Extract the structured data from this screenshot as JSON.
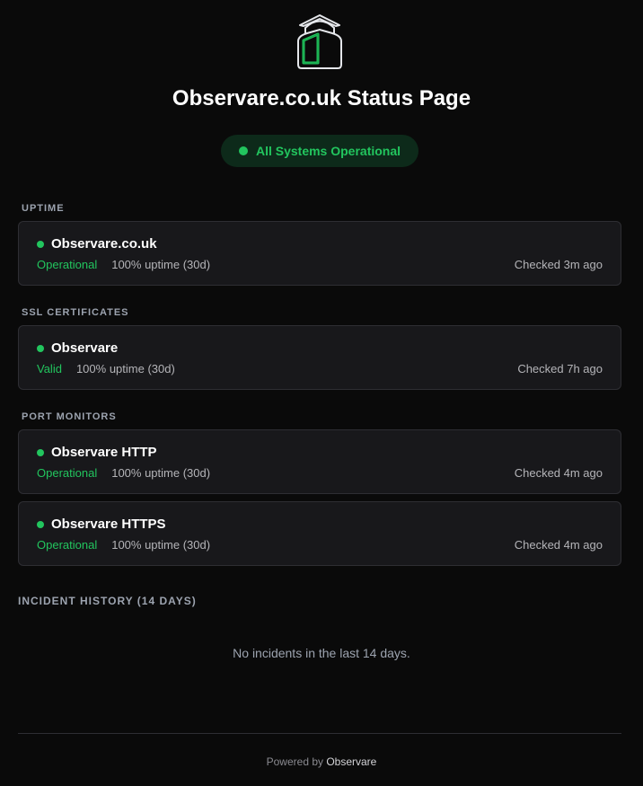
{
  "header": {
    "title": "Observare.co.uk Status Page",
    "overall_status": "All Systems Operational",
    "status_color": "#22c55e",
    "logo_icon": "house-door-icon"
  },
  "sections": {
    "uptime": {
      "label": "UPTIME",
      "items": [
        {
          "name": "Observare.co.uk",
          "status": "Operational",
          "uptime": "100% uptime (30d)",
          "checked": "Checked 3m ago"
        }
      ]
    },
    "ssl": {
      "label": "SSL CERTIFICATES",
      "items": [
        {
          "name": "Observare",
          "status": "Valid",
          "uptime": "100% uptime (30d)",
          "checked": "Checked 7h ago"
        }
      ]
    },
    "ports": {
      "label": "PORT MONITORS",
      "items": [
        {
          "name": "Observare HTTP",
          "status": "Operational",
          "uptime": "100% uptime (30d)",
          "checked": "Checked 4m ago"
        },
        {
          "name": "Observare HTTPS",
          "status": "Operational",
          "uptime": "100% uptime (30d)",
          "checked": "Checked 4m ago"
        }
      ]
    }
  },
  "incidents": {
    "label": "INCIDENT HISTORY (14 DAYS)",
    "empty_text": "No incidents in the last 14 days."
  },
  "footer": {
    "prefix": "Powered by",
    "link": "Observare"
  }
}
